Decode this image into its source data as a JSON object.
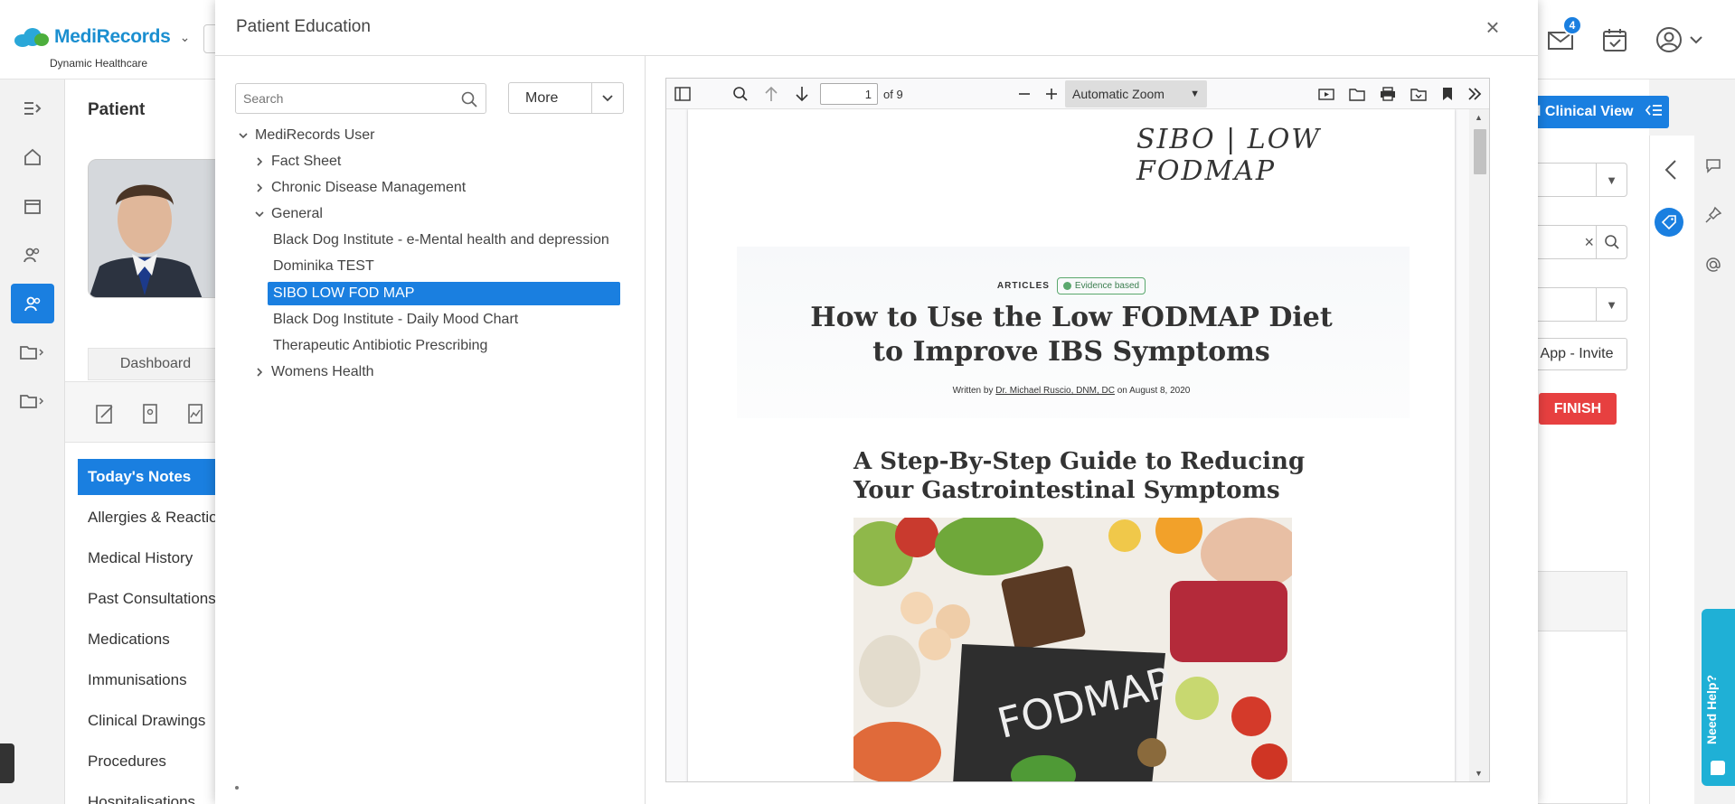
{
  "app": {
    "brand": "MediRecords",
    "subtitle": "Dynamic Healthcare",
    "notification_count": "4"
  },
  "patient_panel": {
    "title": "Patient",
    "dashboard_tab": "Dashboard",
    "nav": [
      "Today's Notes",
      "Allergies & Reactions",
      "Medical History",
      "Past Consultations",
      "Medications",
      "Immunisations",
      "Clinical Drawings",
      "Procedures",
      "Hospitalisations"
    ]
  },
  "right_panel": {
    "clinical_view_label": "and Clinical View",
    "app_invite_label": "App - Invite",
    "finish_label": "FINISH",
    "need_help_label": "Need Help?"
  },
  "modal": {
    "title": "Patient Education",
    "search_placeholder": "Search",
    "more_label": "More",
    "tree": [
      {
        "label": "MediRecords User",
        "level": 0,
        "expanded": true
      },
      {
        "label": "Fact Sheet",
        "level": 1,
        "expanded": false
      },
      {
        "label": "Chronic Disease Management",
        "level": 1,
        "expanded": false
      },
      {
        "label": "General",
        "level": 1,
        "expanded": true
      },
      {
        "label": "Black Dog Institute - e-Mental health and depression",
        "level": 2
      },
      {
        "label": "Dominika TEST",
        "level": 2
      },
      {
        "label": "SIBO LOW FOD MAP",
        "level": 2,
        "selected": true
      },
      {
        "label": "Black Dog Institute - Daily Mood Chart",
        "level": 2
      },
      {
        "label": "Therapeutic Antibiotic Prescribing",
        "level": 2
      },
      {
        "label": "Womens Health",
        "level": 1,
        "expanded": false
      }
    ]
  },
  "pdf_viewer": {
    "page_current": "1",
    "page_total_label": "of 9",
    "zoom": "Automatic Zoom",
    "page": {
      "handwritten_note": "SIBO | LOW FODMAP",
      "section_label": "ARTICLES",
      "badge": "Evidence based",
      "title_line1": "How to Use the Low FODMAP Diet",
      "title_line2": "to Improve IBS Symptoms",
      "byline_prefix": "Written by",
      "byline_author": "Dr. Michael Ruscio, DNM, DC",
      "byline_suffix": "on August 8, 2020",
      "subtitle_line1": "A Step-By-Step Guide to Reducing",
      "subtitle_line2": "Your Gastrointestinal Symptoms",
      "image_chalk_text": "FODMAP"
    }
  },
  "colors": {
    "accent": "#1a7fe0",
    "brand_green": "#4cae3c",
    "finish_red": "#e74040",
    "help_teal": "#1fb0d6"
  }
}
